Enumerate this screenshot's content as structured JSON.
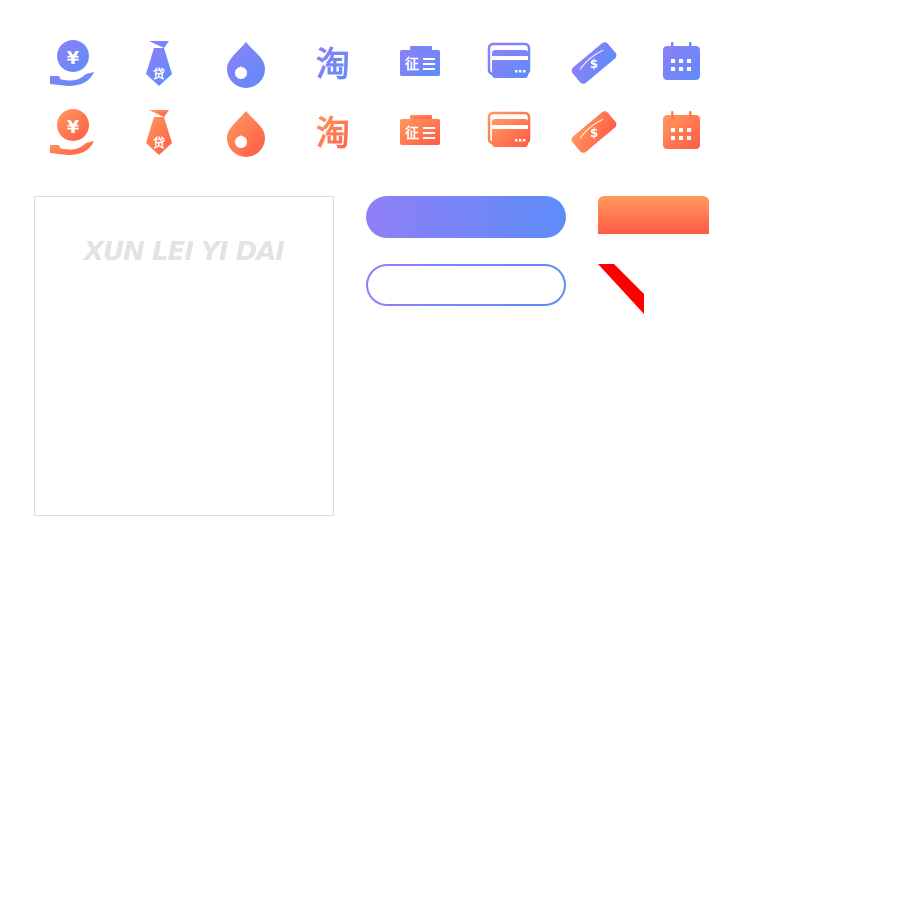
{
  "colors": {
    "blue_start": "#8f7ff7",
    "blue_end": "#5d8cf8",
    "orange_start": "#ff9a5e",
    "orange_end": "#ff5a47",
    "ribbon": "#ff0000",
    "card_border": "#dcdcdc",
    "watermark": "#e3e3e3"
  },
  "icon_rows": [
    {
      "theme": "blue",
      "icons": [
        "yuan-hand-icon",
        "loan-tie-icon",
        "water-drop-icon",
        "taobao-icon",
        "credit-report-icon",
        "bank-card-icon",
        "money-note-icon",
        "calendar-icon"
      ]
    },
    {
      "theme": "orange",
      "icons": [
        "yuan-hand-icon",
        "loan-tie-icon",
        "water-drop-icon",
        "taobao-icon",
        "credit-report-icon",
        "bank-card-icon",
        "money-note-icon",
        "calendar-icon"
      ]
    }
  ],
  "glyphs": {
    "yuan": "¥",
    "loan": "贷",
    "taobao": "淘",
    "credit": "征",
    "dollar": "$"
  },
  "card": {
    "watermark_text": "XUN LEI YI DAI"
  }
}
